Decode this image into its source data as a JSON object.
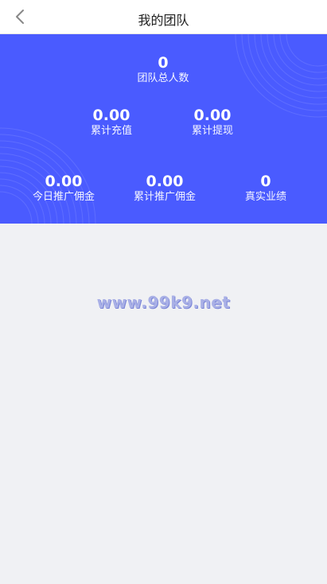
{
  "header": {
    "title": "我的团队",
    "back_icon": "chevron-left-icon"
  },
  "banner": {
    "background_color": "#4a5bff",
    "total": {
      "value": "0",
      "label": "团队总人数"
    },
    "row1": [
      {
        "value": "0.00",
        "label": "累计充值"
      },
      {
        "value": "0.00",
        "label": "累计提现"
      }
    ],
    "row2": [
      {
        "value": "0.00",
        "label": "今日推广佣金"
      },
      {
        "value": "0.00",
        "label": "累计推广佣金"
      },
      {
        "value": "0",
        "label": "真实业绩"
      }
    ]
  },
  "watermark": "www.99k9.net"
}
